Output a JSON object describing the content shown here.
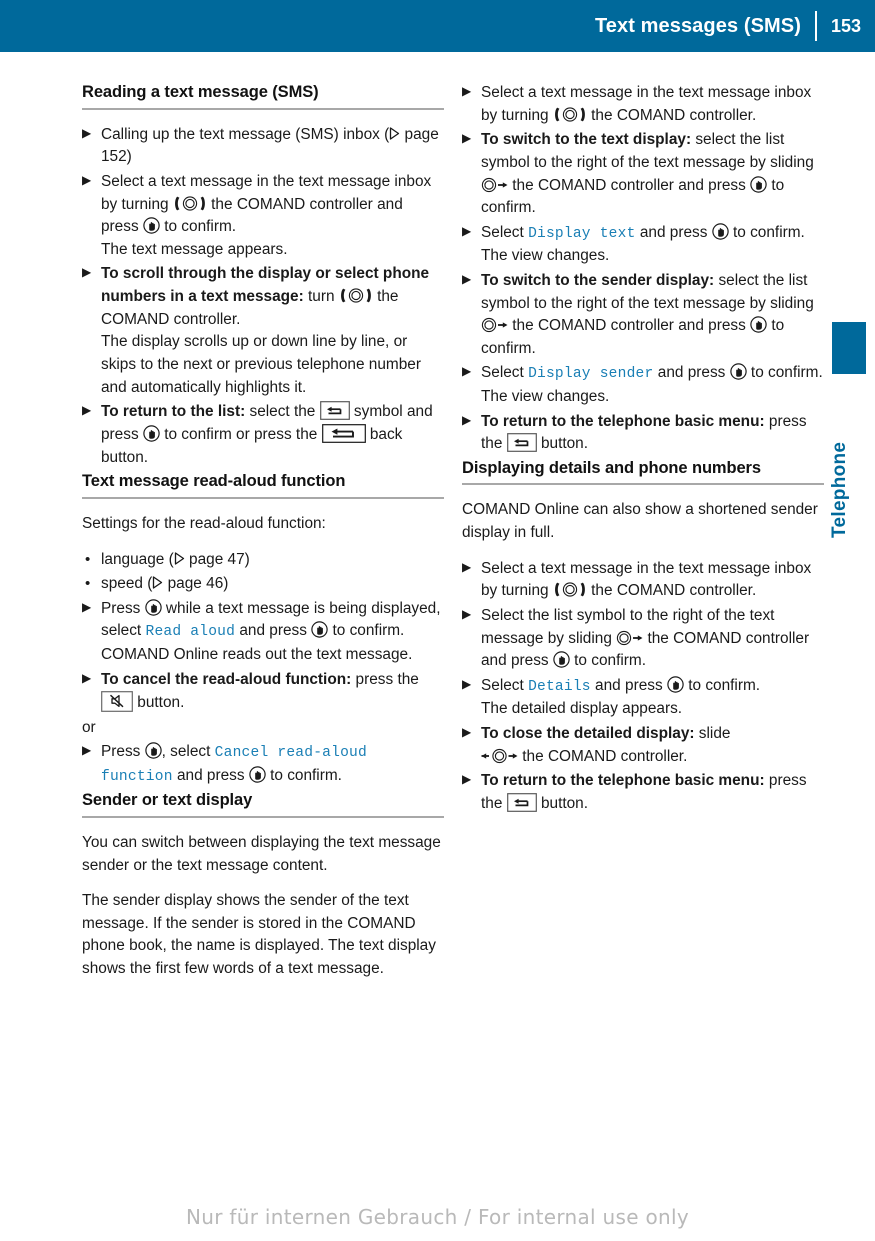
{
  "header": {
    "title": "Text messages (SMS)",
    "page_number": "153",
    "accent_color": "#00699b"
  },
  "side_tab": {
    "label": "Telephone",
    "color": "#00699b"
  },
  "footer": {
    "watermark": "Nur für internen Gebrauch / For internal use only"
  },
  "left_column": {
    "section1": {
      "heading": "Reading a text message (SMS)",
      "step1": {
        "part1": "Calling up the text message (SMS) inbox (",
        "part2": " page 152)"
      },
      "step2": {
        "part1": "Select a text message in the text message inbox by turning ",
        "part2": " the COMAND controller and press ",
        "part3": " to confirm.",
        "result": "The text message appears."
      },
      "step3": {
        "bold": "To scroll through the display or select phone numbers in a text message:",
        "part1": " turn ",
        "part2": " the COMAND controller.",
        "result": "The display scrolls up or down line by line, or skips to the next or previous telephone number and automatically highlights it."
      },
      "step4": {
        "bold": "To return to the list:",
        "part1": " select the ",
        "part2": " symbol and press ",
        "part3": " to confirm or press the ",
        "part4": " back button."
      }
    },
    "section2": {
      "heading": "Text message read-aloud function",
      "intro": "Settings for the read-aloud function:",
      "bullet1": {
        "part1": "language (",
        "part2": " page 47)"
      },
      "bullet2": {
        "part1": "speed (",
        "part2": " page 46)"
      },
      "step1": {
        "part1": "Press ",
        "part2": " while a text message is being displayed, select ",
        "command": "Read aloud",
        "part3": " and press ",
        "part4": " to confirm.",
        "result": "COMAND Online reads out the text message."
      },
      "step2": {
        "bold": "To cancel the read-aloud function:",
        "part1": " press the ",
        "part2": " button."
      },
      "or_label": "or",
      "step3": {
        "part1": "Press ",
        "part2": ", select ",
        "command": "Cancel read-aloud function",
        "part3": " and press ",
        "part4": " to confirm."
      }
    },
    "section3": {
      "heading": "Sender or text display",
      "para1": "You can switch between displaying the text message sender or the text message content.",
      "para2": "The sender display shows the sender of the text message. If the sender is stored in the COMAND phone book, the name is displayed. The text display shows the first few words of a text message."
    }
  },
  "right_column": {
    "section1": {
      "step1": {
        "part1": "Select a text message in the text message inbox by turning ",
        "part2": " the COMAND controller."
      },
      "step2": {
        "bold": "To switch to the text display:",
        "part1": " select the list symbol to the right of the text message by sliding ",
        "part2": " the COMAND controller and press ",
        "part3": " to confirm."
      },
      "step3": {
        "part1": "Select ",
        "command": "Display text",
        "part2": " and press ",
        "part3": " to confirm.",
        "result": "The view changes."
      },
      "step4": {
        "bold": "To switch to the sender display:",
        "part1": " select the list symbol to the right of the text message by sliding ",
        "part2": " the COMAND controller and press ",
        "part3": " to confirm."
      },
      "step5": {
        "part1": "Select ",
        "command": "Display sender",
        "part2": " and press ",
        "part3": " to confirm.",
        "result": "The view changes."
      },
      "step6": {
        "bold": "To return to the telephone basic menu:",
        "part1": " press the ",
        "part2": " button."
      }
    },
    "section2": {
      "heading": "Displaying details and phone numbers",
      "intro": "COMAND Online can also show a shortened sender display in full.",
      "step1": {
        "part1": "Select a text message in the text message inbox by turning ",
        "part2": " the COMAND controller."
      },
      "step2": {
        "part1": "Select the list symbol to the right of the text message by sliding ",
        "part2": " the COMAND controller and press ",
        "part3": " to confirm."
      },
      "step3": {
        "part1": "Select ",
        "command": "Details",
        "part2": " and press ",
        "part3": " to confirm.",
        "result": "The detailed display appears."
      },
      "step4": {
        "bold": "To close the detailed display:",
        "part1": " slide ",
        "part2": " the COMAND controller."
      },
      "step5": {
        "bold": "To return to the telephone basic menu:",
        "part1": " press the ",
        "part2": " button."
      }
    }
  },
  "icons": {
    "step_marker": "▶",
    "bullet_marker": "•",
    "turn_controller": "turn-controller-icon",
    "press_controller": "press-controller-icon",
    "slide_right": "slide-right-icon",
    "slide_both": "slide-left-right-icon",
    "page_ref": "page-reference-triangle-icon",
    "back_symbol": "back-symbol-icon",
    "back_button": "back-button-icon",
    "mute_button": "mute-button-icon"
  }
}
